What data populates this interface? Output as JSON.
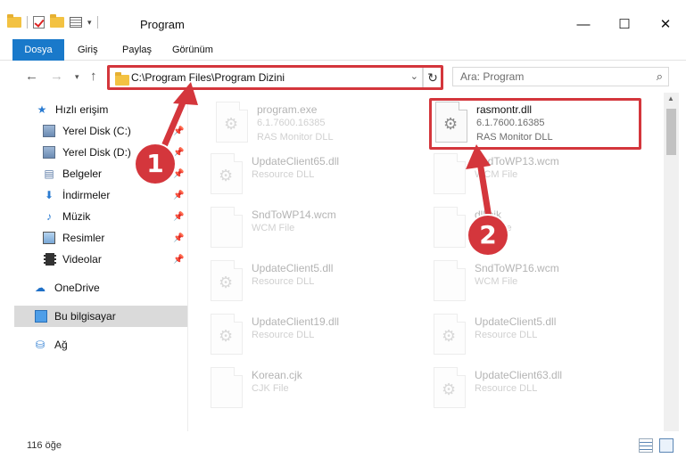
{
  "window": {
    "title": "Program",
    "minimize": "—",
    "maximize": "☐",
    "close": "✕"
  },
  "ribbon": {
    "tabs": [
      "Dosya",
      "Giriş",
      "Paylaş",
      "Görünüm"
    ]
  },
  "address": {
    "path": "C:\\Program Files\\Program Dizini",
    "search_placeholder": "Ara: Program"
  },
  "sidebar": {
    "items": [
      {
        "label": "Hızlı erişim"
      },
      {
        "label": "Yerel Disk (C:)"
      },
      {
        "label": "Yerel Disk (D:)"
      },
      {
        "label": "Belgeler"
      },
      {
        "label": "İndirmeler"
      },
      {
        "label": "Müzik"
      },
      {
        "label": "Resimler"
      },
      {
        "label": "Videolar"
      },
      {
        "label": "OneDrive"
      },
      {
        "label": "Bu bilgisayar"
      },
      {
        "label": "Ağ"
      }
    ]
  },
  "files": [
    {
      "name": "program.exe",
      "type": "6.1.7600.16385",
      "desc": "RAS Monitor DLL",
      "highlight": false
    },
    {
      "name": "rasmontr.dll",
      "type": "6.1.7600.16385",
      "desc": "RAS Monitor DLL",
      "highlight": true
    },
    {
      "name": "UpdateClient65.dll",
      "type": "Resource DLL",
      "desc": ""
    },
    {
      "name": "SndToWP13.wcm",
      "type": "WCM File",
      "desc": ""
    },
    {
      "name": "SndToWP14.wcm",
      "type": "WCM File",
      "desc": ""
    },
    {
      "name": "dll.cjk",
      "type": "CJK File",
      "desc": ""
    },
    {
      "name": "UpdateClient5.dll",
      "type": "Resource DLL",
      "desc": ""
    },
    {
      "name": "SndToWP16.wcm",
      "type": "WCM File",
      "desc": ""
    },
    {
      "name": "UpdateClient19.dll",
      "type": "Resource DLL",
      "desc": ""
    },
    {
      "name": "UpdateClient5.dll",
      "type": "Resource DLL",
      "desc": ""
    },
    {
      "name": "Korean.cjk",
      "type": "CJK File",
      "desc": ""
    },
    {
      "name": "UpdateClient63.dll",
      "type": "Resource DLL",
      "desc": ""
    }
  ],
  "callouts": {
    "one": "1",
    "two": "2"
  },
  "status": {
    "count": "116 öğe"
  },
  "colors": {
    "accent": "#1979ca",
    "callout": "#d4363c"
  }
}
